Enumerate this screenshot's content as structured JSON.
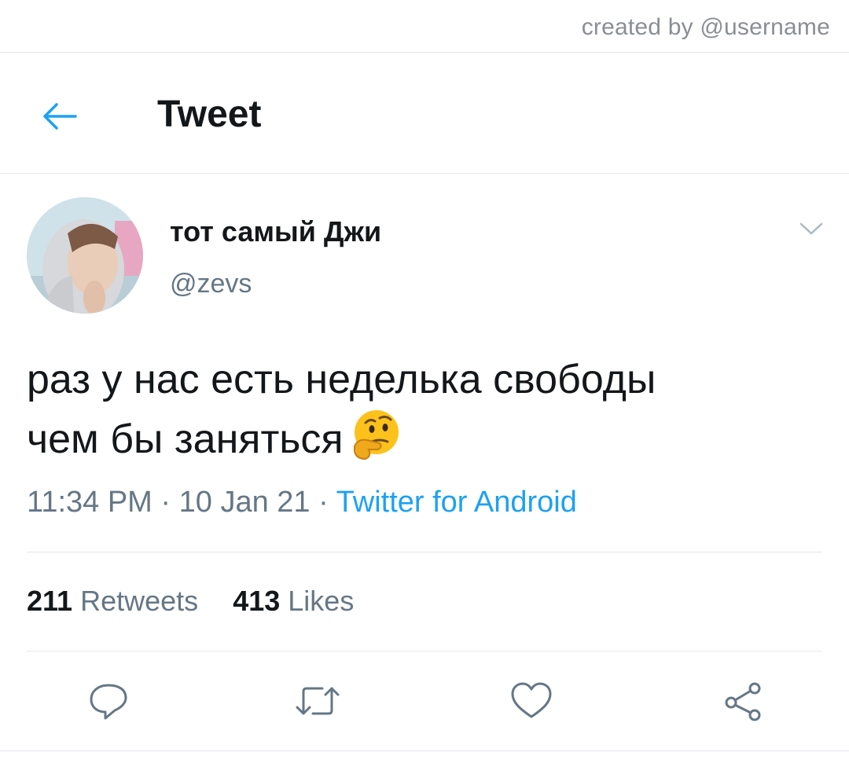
{
  "watermark": "created by @username",
  "header": {
    "title": "Tweet",
    "back_icon": "arrow-left-icon"
  },
  "author": {
    "display_name": "тот самый Джи",
    "handle": "@zevs"
  },
  "tweet": {
    "line1": "раз у нас есть неделька свободы",
    "line2": "чем бы заняться",
    "emoji": "thinking-face-icon"
  },
  "meta": {
    "time": "11:34 PM",
    "sep1": " · ",
    "date": "10 Jan 21",
    "sep2": " · ",
    "source": "Twitter for Android"
  },
  "stats": {
    "retweets_count": "211",
    "retweets_label": "Retweets",
    "likes_count": "413",
    "likes_label": "Likes"
  },
  "actions": [
    "reply-icon",
    "retweet-icon",
    "like-icon",
    "share-icon"
  ],
  "colors": {
    "accent": "#1da1f2",
    "text": "#14171a",
    "secondary": "#657786",
    "divider": "#e1e8ed"
  }
}
